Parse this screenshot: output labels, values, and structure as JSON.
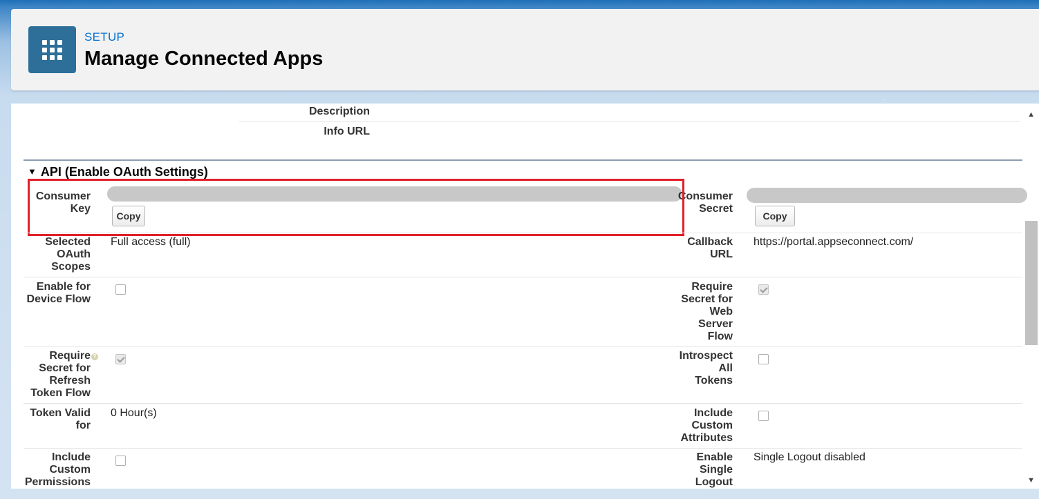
{
  "header": {
    "breadcrumb": "SETUP",
    "title": "Manage Connected Apps"
  },
  "basic": {
    "description_label": "Description",
    "info_url_label": "Info URL"
  },
  "section": {
    "title": "API (Enable OAuth Settings)"
  },
  "fields": {
    "consumer_key": {
      "label": "Consumer\nKey",
      "copy_label": "Copy"
    },
    "consumer_secret": {
      "label": "Consumer\nSecret",
      "copy_label": "Copy"
    },
    "oauth_scopes": {
      "label": "Selected\nOAuth\nScopes",
      "value": "Full access (full)"
    },
    "callback_url": {
      "label": "Callback\nURL",
      "value": "https://portal.appseconnect.com/"
    },
    "device_flow": {
      "label": "Enable for\nDevice Flow",
      "checked": false
    },
    "secret_web_server": {
      "label": "Require\nSecret for\nWeb\nServer\nFlow",
      "checked": true
    },
    "secret_refresh": {
      "label": "Require\nSecret for\nRefresh\nToken Flow",
      "checked": true
    },
    "introspect_tokens": {
      "label": "Introspect\nAll\nTokens",
      "checked": false
    },
    "token_valid": {
      "label": "Token Valid\nfor",
      "value": "0 Hour(s)"
    },
    "custom_attributes": {
      "label": "Include\nCustom\nAttributes",
      "checked": false
    },
    "custom_permissions": {
      "label": "Include\nCustom\nPermissions",
      "checked": false
    },
    "single_logout": {
      "label": "Enable\nSingle\nLogout",
      "value": "Single Logout disabled"
    }
  },
  "icons": {
    "app": "app-grid-icon",
    "toggle": "triangle-down-icon",
    "help": "help-icon"
  },
  "colors": {
    "accent": "#0070d2",
    "icon_bg": "#2d6f99",
    "highlight": "#e0202a"
  }
}
